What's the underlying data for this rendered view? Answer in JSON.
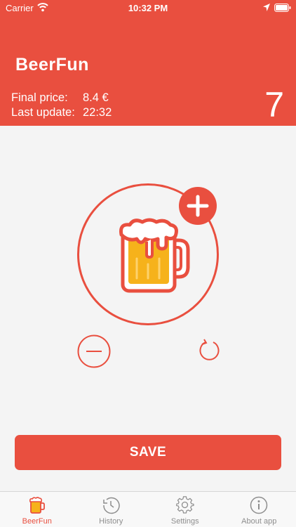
{
  "status_bar": {
    "carrier": "Carrier",
    "time": "10:32 PM"
  },
  "header": {
    "title": "BeerFun",
    "final_price_label": "Final price:",
    "final_price_value": "8.4 €",
    "last_update_label": "Last update:",
    "last_update_value": "22:32",
    "count": "7"
  },
  "actions": {
    "save_label": "SAVE"
  },
  "tabs": [
    {
      "label": "BeerFun",
      "icon": "beer-mug-icon",
      "active": true
    },
    {
      "label": "History",
      "icon": "history-icon",
      "active": false
    },
    {
      "label": "Settings",
      "icon": "gear-icon",
      "active": false
    },
    {
      "label": "About app",
      "icon": "info-icon",
      "active": false
    }
  ],
  "colors": {
    "accent": "#e94f3f",
    "background": "#f4f4f4",
    "beer": "#f6b21b",
    "inactive_tab": "#8e8e8e"
  }
}
